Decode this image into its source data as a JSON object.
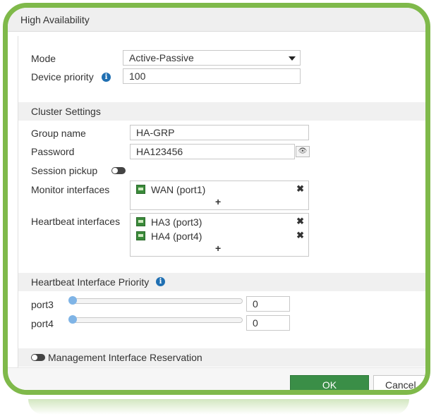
{
  "dialog": {
    "title": "High Availability"
  },
  "general": {
    "mode_label": "Mode",
    "mode_value": "Active-Passive",
    "priority_label": "Device priority",
    "priority_value": "100",
    "info_icon": "info-icon"
  },
  "cluster": {
    "section_title": "Cluster Settings",
    "group_name_label": "Group name",
    "group_name_value": "HA-GRP",
    "password_label": "Password",
    "password_value": "HA123456",
    "session_pickup_label": "Session pickup",
    "session_pickup_on": false,
    "monitor_label": "Monitor interfaces",
    "monitor_items": [
      {
        "label": "WAN (port1)"
      }
    ],
    "heartbeat_label": "Heartbeat interfaces",
    "heartbeat_items": [
      {
        "label": "HA3 (port3)"
      },
      {
        "label": "HA4 (port4)"
      }
    ],
    "add_symbol": "+",
    "remove_symbol": "✖"
  },
  "priority": {
    "section_title": "Heartbeat Interface Priority",
    "rows": [
      {
        "port": "port3",
        "value": "0"
      },
      {
        "port": "port4",
        "value": "0"
      }
    ]
  },
  "management": {
    "label": "Management Interface Reservation",
    "enabled": false
  },
  "footer": {
    "ok_label": "OK",
    "cancel_label": "Cancel"
  },
  "colors": {
    "frame": "#7fb94a",
    "ok": "#3a8e47",
    "info": "#1f6fb2",
    "slider_thumb": "#7fb4e6"
  }
}
